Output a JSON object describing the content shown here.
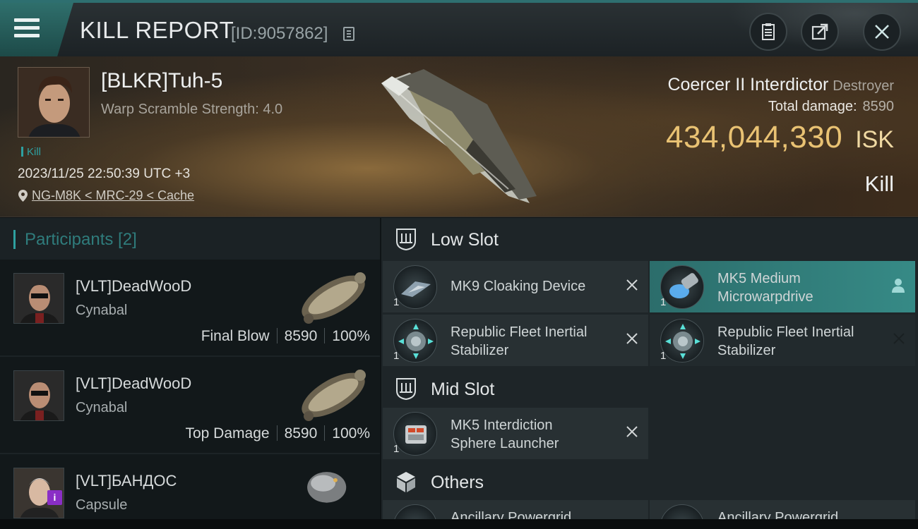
{
  "header": {
    "title": "KILL REPORT",
    "id_label": "[ID:9057862]",
    "icons": [
      "menu-icon",
      "copy-icon",
      "clipboard-icon",
      "share-icon",
      "close-icon"
    ]
  },
  "victim": {
    "name": "[BLKR]Tuh-5",
    "warp_scramble": "Warp Scramble Strength: 4.0",
    "tag": "Kill",
    "datetime": "2023/11/25 22:50:39 UTC +3",
    "location": "NG-M8K < MRC-29 < Cache",
    "ship_name": "Coercer II Interdictor",
    "ship_class": "Destroyer",
    "total_damage_label": "Total damage:",
    "total_damage_value": "8590",
    "isk_value": "434,044,330",
    "isk_unit": "ISK",
    "result": "Kill"
  },
  "participants": {
    "header": "Participants [2]",
    "rows": [
      {
        "name": "[VLT]DeadWooD",
        "ship": "Cynabal",
        "role": "Final Blow",
        "damage": "8590",
        "percent": "100%"
      },
      {
        "name": "[VLT]DeadWooD",
        "ship": "Cynabal",
        "role": "Top Damage",
        "damage": "8590",
        "percent": "100%"
      },
      {
        "name": "[VLT]БАНДОС",
        "ship": "Capsule",
        "badge": "i"
      }
    ]
  },
  "fittings": {
    "low_slot": {
      "title": "Low Slot",
      "modules": [
        {
          "qty": "1",
          "name": "MK9 Cloaking Device"
        },
        {
          "qty": "1",
          "name_line1": "MK5 Medium",
          "name_line2": "Microwarpdrive"
        },
        {
          "qty": "1",
          "name_line1": "Republic Fleet Inertial",
          "name_line2": "Stabilizer"
        },
        {
          "qty": "1",
          "name_line1": "Republic Fleet Inertial",
          "name_line2": "Stabilizer"
        }
      ]
    },
    "mid_slot": {
      "title": "Mid Slot",
      "modules": [
        {
          "qty": "1",
          "name_line1": "MK5 Interdiction",
          "name_line2": "Sphere Launcher"
        }
      ]
    },
    "others": {
      "title": "Others",
      "modules": [
        {
          "name": "Ancillary Powergrid"
        },
        {
          "name": "Ancillary Powergrid"
        }
      ]
    }
  },
  "colors": {
    "accent_teal": "#2ea0a0",
    "isk_gold": "#e9c273",
    "active_module": "#2c6d6b"
  }
}
